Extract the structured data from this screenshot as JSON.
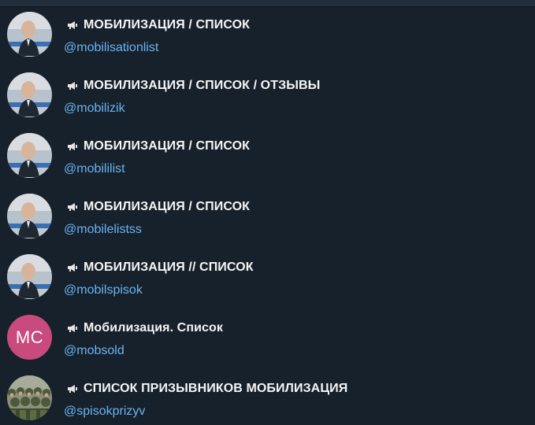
{
  "colors": {
    "background": "#17212b",
    "title_text": "#f5f5f5",
    "handle_text": "#6ab3f3",
    "initials_avatar_bg": "#c94a7c"
  },
  "channels": [
    {
      "title": "МОБИЛИЗАЦИЯ / СПИСОК",
      "handle": "@mobilisationlist",
      "icon": "megaphone-icon",
      "avatar": "photo"
    },
    {
      "title": "МОБИЛИЗАЦИЯ / СПИСОК / ОТЗЫВЫ",
      "handle": "@mobilizik",
      "icon": "megaphone-icon",
      "avatar": "photo"
    },
    {
      "title": "МОБИЛИЗАЦИЯ / СПИСОК",
      "handle": "@mobililist",
      "icon": "megaphone-icon",
      "avatar": "photo"
    },
    {
      "title": "МОБИЛИЗАЦИЯ / СПИСОК",
      "handle": "@mobilelistss",
      "icon": "megaphone-icon",
      "avatar": "photo"
    },
    {
      "title": "МОБИЛИЗАЦИЯ // СПИСОК",
      "handle": "@mobilspisok",
      "icon": "megaphone-icon",
      "avatar": "photo"
    },
    {
      "title": "Мобилизация. Список",
      "handle": "@mobsold",
      "icon": "megaphone-icon",
      "avatar": "initials",
      "initials": "MC"
    },
    {
      "title": "СПИСОК ПРИЗЫВНИКОВ МОБИЛИЗАЦИЯ",
      "handle": "@spisokprizyv",
      "icon": "megaphone-icon",
      "avatar": "photo-soldiers"
    }
  ]
}
